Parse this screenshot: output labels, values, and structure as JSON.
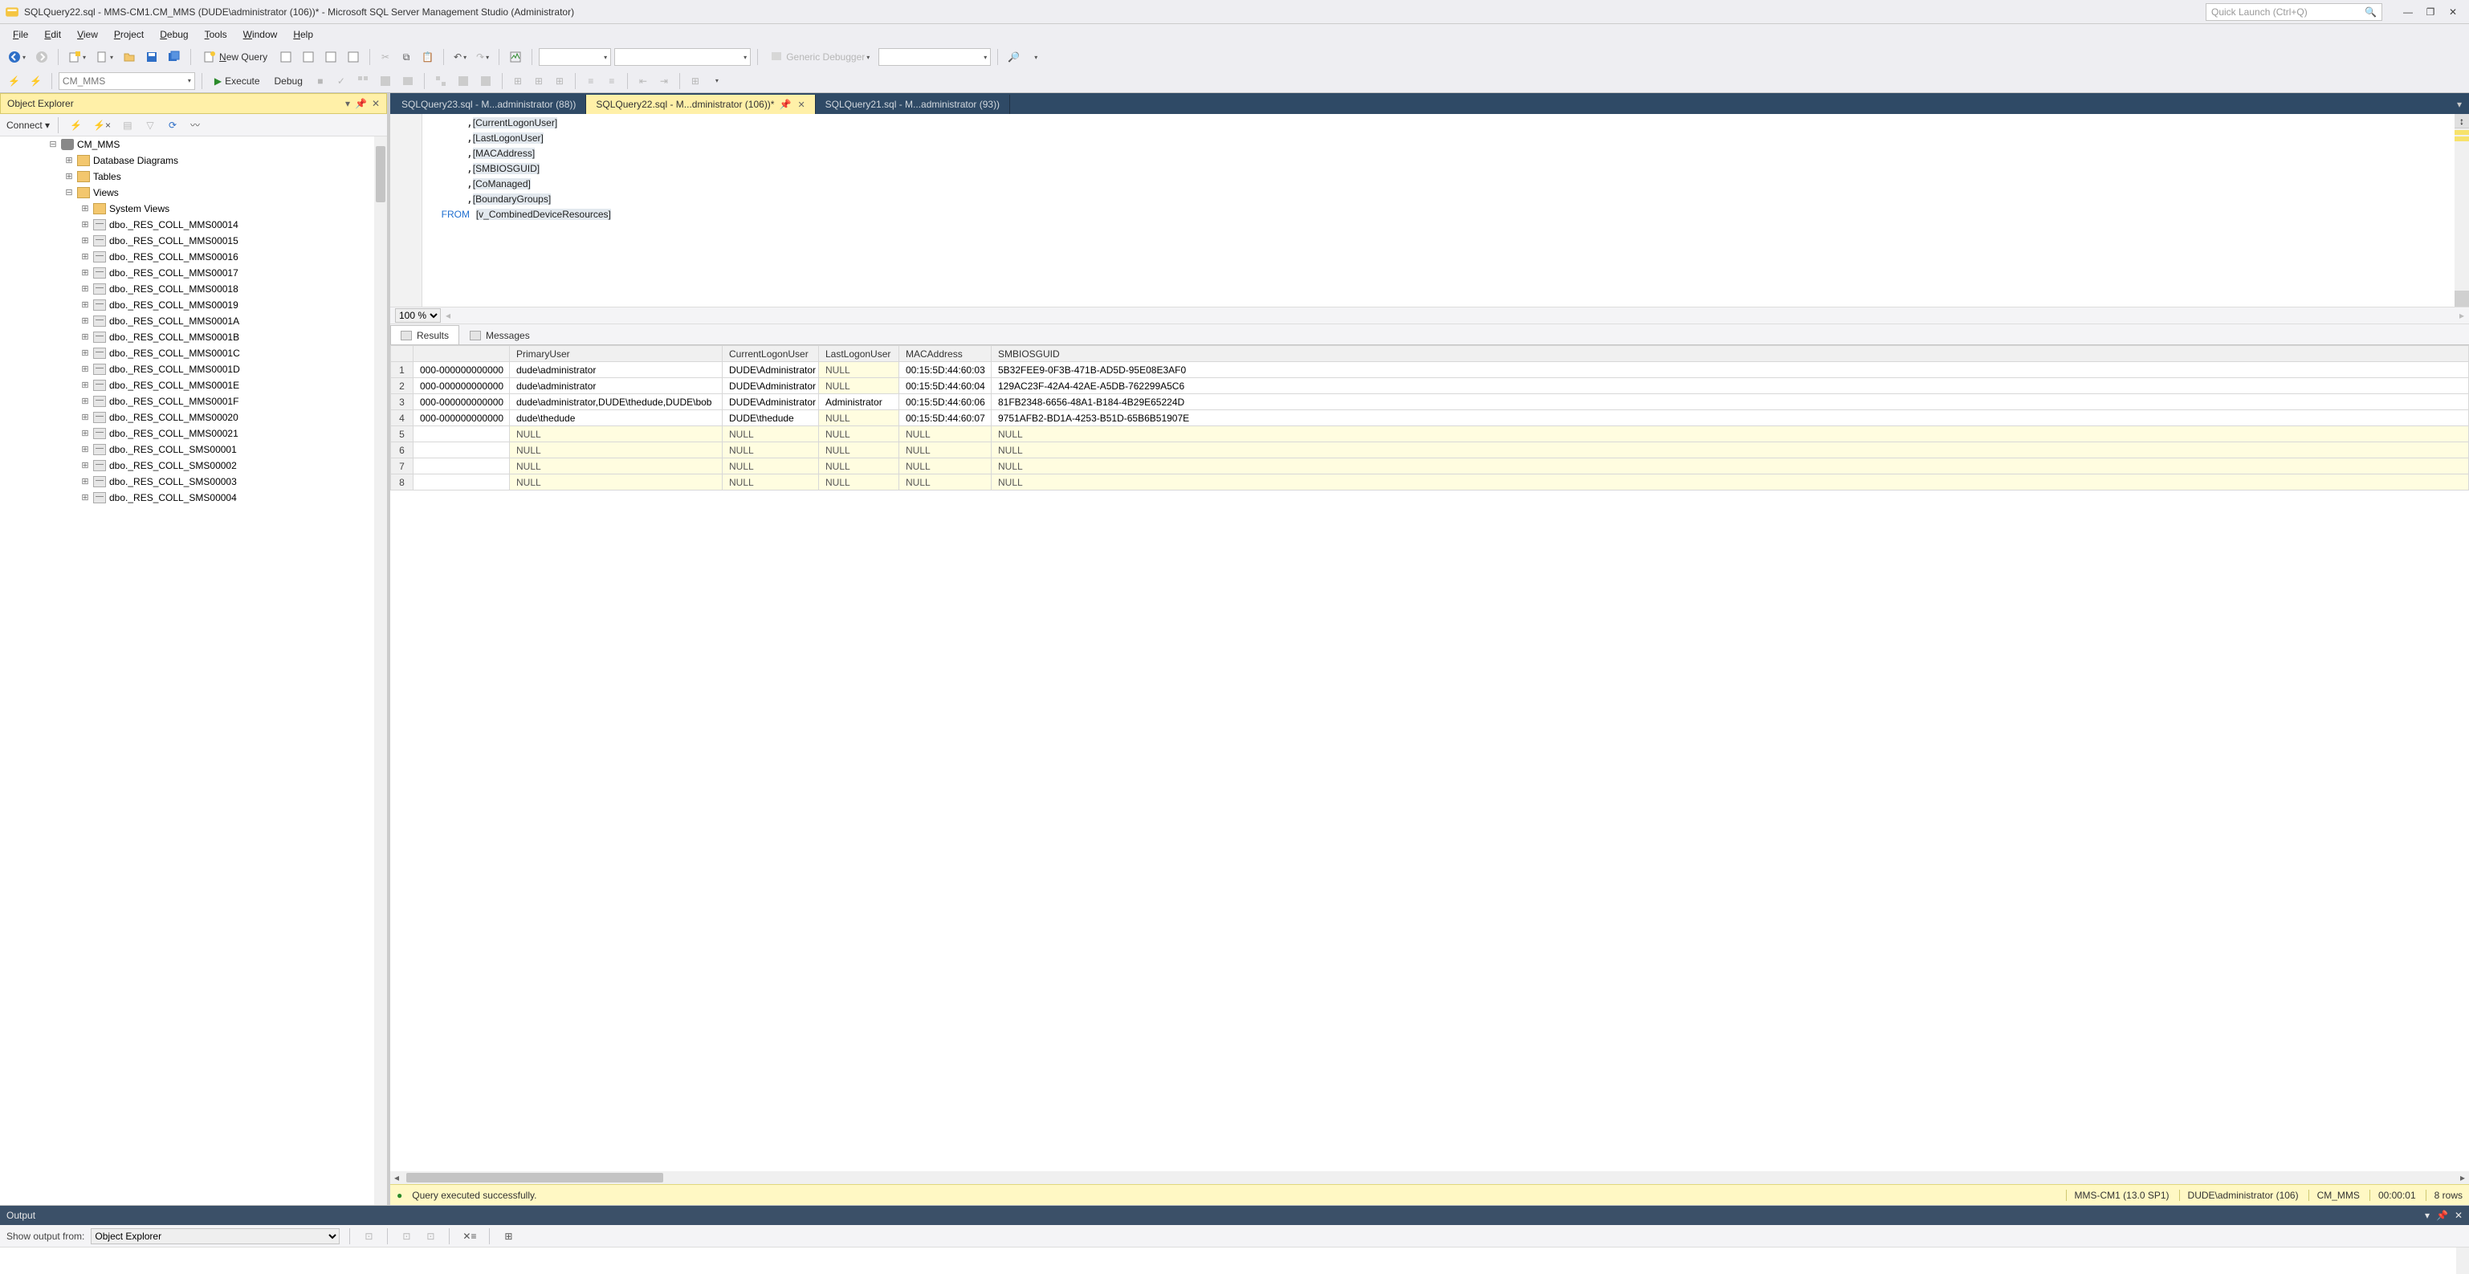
{
  "window": {
    "title": "SQLQuery22.sql - MMS-CM1.CM_MMS (DUDE\\administrator (106))* - Microsoft SQL Server Management Studio (Administrator)",
    "quick_launch_placeholder": "Quick Launch (Ctrl+Q)"
  },
  "menu": {
    "file": "File",
    "edit": "Edit",
    "view": "View",
    "project": "Project",
    "debug": "Debug",
    "tools": "Tools",
    "window": "Window",
    "help": "Help"
  },
  "toolbar1": {
    "new_query": "New Query",
    "generic_debugger": "Generic Debugger"
  },
  "toolbar2": {
    "db_combo": "CM_MMS",
    "execute": "Execute",
    "debug": "Debug"
  },
  "object_explorer": {
    "title": "Object Explorer",
    "connect": "Connect",
    "db": "CM_MMS",
    "folders": {
      "database_diagrams": "Database Diagrams",
      "tables": "Tables",
      "views": "Views",
      "system_views": "System Views"
    },
    "views": [
      "dbo._RES_COLL_MMS00014",
      "dbo._RES_COLL_MMS00015",
      "dbo._RES_COLL_MMS00016",
      "dbo._RES_COLL_MMS00017",
      "dbo._RES_COLL_MMS00018",
      "dbo._RES_COLL_MMS00019",
      "dbo._RES_COLL_MMS0001A",
      "dbo._RES_COLL_MMS0001B",
      "dbo._RES_COLL_MMS0001C",
      "dbo._RES_COLL_MMS0001D",
      "dbo._RES_COLL_MMS0001E",
      "dbo._RES_COLL_MMS0001F",
      "dbo._RES_COLL_MMS00020",
      "dbo._RES_COLL_MMS00021",
      "dbo._RES_COLL_SMS00001",
      "dbo._RES_COLL_SMS00002",
      "dbo._RES_COLL_SMS00003",
      "dbo._RES_COLL_SMS00004"
    ]
  },
  "tabs": [
    {
      "label": "SQLQuery23.sql - M...administrator (88))"
    },
    {
      "label": "SQLQuery22.sql - M...dministrator (106))*"
    },
    {
      "label": "SQLQuery21.sql - M...administrator (93))"
    }
  ],
  "sql": {
    "lines": [
      "      ,[CurrentLogonUser]",
      "      ,[LastLogonUser]",
      "      ,[MACAddress]",
      "      ,[SMBIOSGUID]",
      "      ,[CoManaged]",
      "      ,[BoundaryGroups]",
      "  FROM [v_CombinedDeviceResources]"
    ]
  },
  "zoom": {
    "value": "100 %"
  },
  "results_tabs": {
    "results": "Results",
    "messages": "Messages"
  },
  "grid": {
    "columns": [
      "",
      "PrimaryUser",
      "CurrentLogonUser",
      "LastLogonUser",
      "MACAddress",
      "SMBIOSGUID"
    ],
    "rows": [
      {
        "n": "1",
        "c0": "000-000000000000",
        "primary": "dude\\administrator",
        "cur": "DUDE\\Administrator",
        "last": "NULL",
        "mac": "00:15:5D:44:60:03",
        "smb": "5B32FEE9-0F3B-471B-AD5D-95E08E3AF0"
      },
      {
        "n": "2",
        "c0": "000-000000000000",
        "primary": "dude\\administrator",
        "cur": "DUDE\\Administrator",
        "last": "NULL",
        "mac": "00:15:5D:44:60:04",
        "smb": "129AC23F-42A4-42AE-A5DB-762299A5C6"
      },
      {
        "n": "3",
        "c0": "000-000000000000",
        "primary": "dude\\administrator,DUDE\\thedude,DUDE\\bob",
        "cur": "DUDE\\Administrator",
        "last": "Administrator",
        "mac": "00:15:5D:44:60:06",
        "smb": "81FB2348-6656-48A1-B184-4B29E65224D"
      },
      {
        "n": "4",
        "c0": "000-000000000000",
        "primary": "dude\\thedude",
        "cur": "DUDE\\thedude",
        "last": "NULL",
        "mac": "00:15:5D:44:60:07",
        "smb": "9751AFB2-BD1A-4253-B51D-65B6B51907E"
      },
      {
        "n": "5",
        "c0": "",
        "primary": "NULL",
        "cur": "NULL",
        "last": "NULL",
        "mac": "NULL",
        "smb": "NULL"
      },
      {
        "n": "6",
        "c0": "",
        "primary": "NULL",
        "cur": "NULL",
        "last": "NULL",
        "mac": "NULL",
        "smb": "NULL"
      },
      {
        "n": "7",
        "c0": "",
        "primary": "NULL",
        "cur": "NULL",
        "last": "NULL",
        "mac": "NULL",
        "smb": "NULL"
      },
      {
        "n": "8",
        "c0": "",
        "primary": "NULL",
        "cur": "NULL",
        "last": "NULL",
        "mac": "NULL",
        "smb": "NULL"
      }
    ]
  },
  "status": {
    "msg": "Query executed successfully.",
    "server": "MMS-CM1 (13.0 SP1)",
    "user": "DUDE\\administrator (106)",
    "db": "CM_MMS",
    "elapsed": "00:00:01",
    "rows": "8 rows"
  },
  "output": {
    "title": "Output",
    "show_label": "Show output from:",
    "source": "Object Explorer"
  }
}
